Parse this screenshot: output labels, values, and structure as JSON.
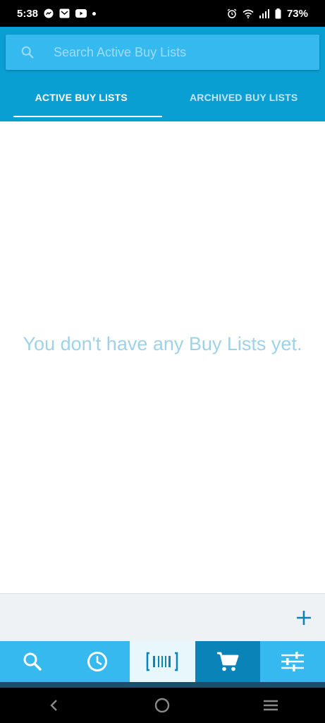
{
  "status_bar": {
    "time": "5:38",
    "battery": "73%"
  },
  "search": {
    "placeholder": "Search Active Buy Lists",
    "value": ""
  },
  "tabs": [
    {
      "label": "ACTIVE BUY LISTS",
      "active": true
    },
    {
      "label": "ARCHIVED BUY LISTS",
      "active": false
    }
  ],
  "main": {
    "empty_message": "You don't have any Buy Lists yet."
  },
  "bottom_nav": {
    "items": [
      {
        "icon": "search-icon"
      },
      {
        "icon": "clock-icon"
      },
      {
        "icon": "barcode-icon"
      },
      {
        "icon": "cart-icon",
        "selected": true
      },
      {
        "icon": "sliders-icon"
      }
    ]
  },
  "colors": {
    "header": "#0a9fd3",
    "search_bg": "#36b9ef",
    "empty_text": "#9fd2e8",
    "accent": "#0a84b8"
  }
}
